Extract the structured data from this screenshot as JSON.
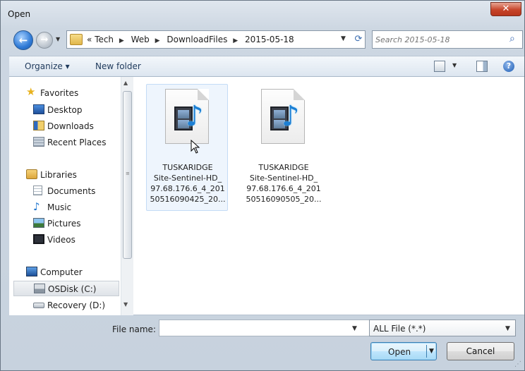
{
  "window": {
    "title": "Open",
    "close_glyph": "✕"
  },
  "nav": {
    "back_glyph": "←",
    "forward_glyph": "→",
    "breadcrumbs": [
      "« Tech",
      "Web",
      "DownloadFiles",
      "2015-05-18"
    ],
    "breadcrumb_separator": "▶",
    "refresh_glyph": "⟳",
    "search_placeholder": "Search 2015-05-18"
  },
  "toolbar": {
    "organize_label": "Organize ▾",
    "new_folder_label": "New folder",
    "help_glyph": "?"
  },
  "sidebar": {
    "items": [
      {
        "label": "Favorites",
        "icon": "star-icon",
        "group": true
      },
      {
        "label": "Desktop",
        "icon": "desktop-icon"
      },
      {
        "label": "Downloads",
        "icon": "downloads-icon"
      },
      {
        "label": "Recent Places",
        "icon": "recent-places-icon"
      },
      {
        "label": "Libraries",
        "icon": "libraries-icon",
        "group": true
      },
      {
        "label": "Documents",
        "icon": "documents-icon"
      },
      {
        "label": "Music",
        "icon": "music-icon"
      },
      {
        "label": "Pictures",
        "icon": "pictures-icon"
      },
      {
        "label": "Videos",
        "icon": "videos-icon"
      },
      {
        "label": "Computer",
        "icon": "computer-icon",
        "group": true
      },
      {
        "label": "OSDisk (C:)",
        "icon": "disk-icon",
        "selected": true
      },
      {
        "label": "Recovery (D:)",
        "icon": "drive-icon"
      }
    ]
  },
  "files": [
    {
      "name_lines": [
        "TUSKARIDGE",
        "Site-Sentinel-HD_",
        "97.68.176.6_4_201",
        "50516090425_20..."
      ],
      "icon": "media-file-icon",
      "hovered": true
    },
    {
      "name_lines": [
        "TUSKARIDGE",
        "Site-Sentinel-HD_",
        "97.68.176.6_4_201",
        "50516090505_20..."
      ],
      "icon": "media-file-icon",
      "hovered": false
    }
  ],
  "bottom": {
    "file_name_label": "File name:",
    "file_name_value": "",
    "file_type": "ALL File (*.*)",
    "open_label": "Open",
    "cancel_label": "Cancel"
  },
  "colors": {
    "accent": "#3c7fb1",
    "close_red": "#c7452a",
    "selection_bg": "#eef5fd"
  }
}
